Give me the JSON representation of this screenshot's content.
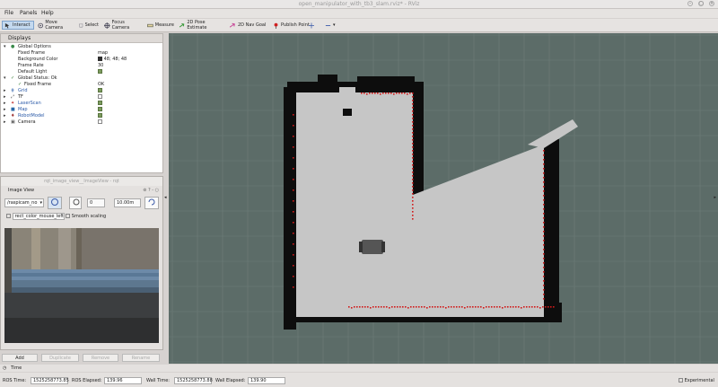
{
  "window": {
    "title": "open_manipulator_with_tb3_slam.rviz* - RViz"
  },
  "menu": {
    "file": "File",
    "panels": "Panels",
    "help": "Help"
  },
  "toolbar": {
    "interact": "Interact",
    "move_camera": "Move Camera",
    "select": "Select",
    "focus_camera": "Focus Camera",
    "measure": "Measure",
    "pose_estimate": "2D Pose Estimate",
    "nav_goal": "2D Nav Goal",
    "publish_point": "Publish Point"
  },
  "displays": {
    "title": "Displays",
    "global_options": "Global Options",
    "fixed_frame_label": "Fixed Frame",
    "fixed_frame_value": "map",
    "background_color_label": "Background Color",
    "background_color_value": "48; 48; 48",
    "frame_rate_label": "Frame Rate",
    "frame_rate_value": "30",
    "default_light_label": "Default Light",
    "global_status_label": "Global Status: Ok",
    "fixed_frame_status_label": "Fixed Frame",
    "fixed_frame_status_value": "OK",
    "items": [
      {
        "label": "Grid",
        "checked": true
      },
      {
        "label": "TF",
        "checked": false
      },
      {
        "label": "LaserScan",
        "checked": true
      },
      {
        "label": "Map",
        "checked": true
      },
      {
        "label": "RobotModel",
        "checked": true
      },
      {
        "label": "Camera",
        "checked": false
      }
    ]
  },
  "image_view": {
    "window_title": "rqt_image_view__ImageView - rqt",
    "panel_title": "Image View",
    "topic": "/raspicam_no",
    "value_min": "0",
    "value_max": "10.00m",
    "mouse_topic": "rect_color_mouse_left",
    "smooth_scaling": "Smooth scaling"
  },
  "buttons": {
    "add": "Add",
    "duplicate": "Duplicate",
    "remove": "Remove",
    "rename": "Rename"
  },
  "time_panel": {
    "title": "Time"
  },
  "status": {
    "ros_time_label": "ROS Time:",
    "ros_time": "1525258773.85",
    "ros_elapsed_label": "ROS Elapsed:",
    "ros_elapsed": "139.96",
    "wall_time_label": "Wall Time:",
    "wall_time": "1525258773.88",
    "wall_elapsed_label": "Wall Elapsed:",
    "wall_elapsed": "139.90",
    "experimental": "Experimental"
  },
  "colors": {
    "viewport_bg": "#5c6c68",
    "grid_line": "#6f7e7a",
    "free_space": "#c6c6c6",
    "obstacle": "#0d0d0d",
    "laser": "#d21a1a",
    "robot": "#555555"
  }
}
